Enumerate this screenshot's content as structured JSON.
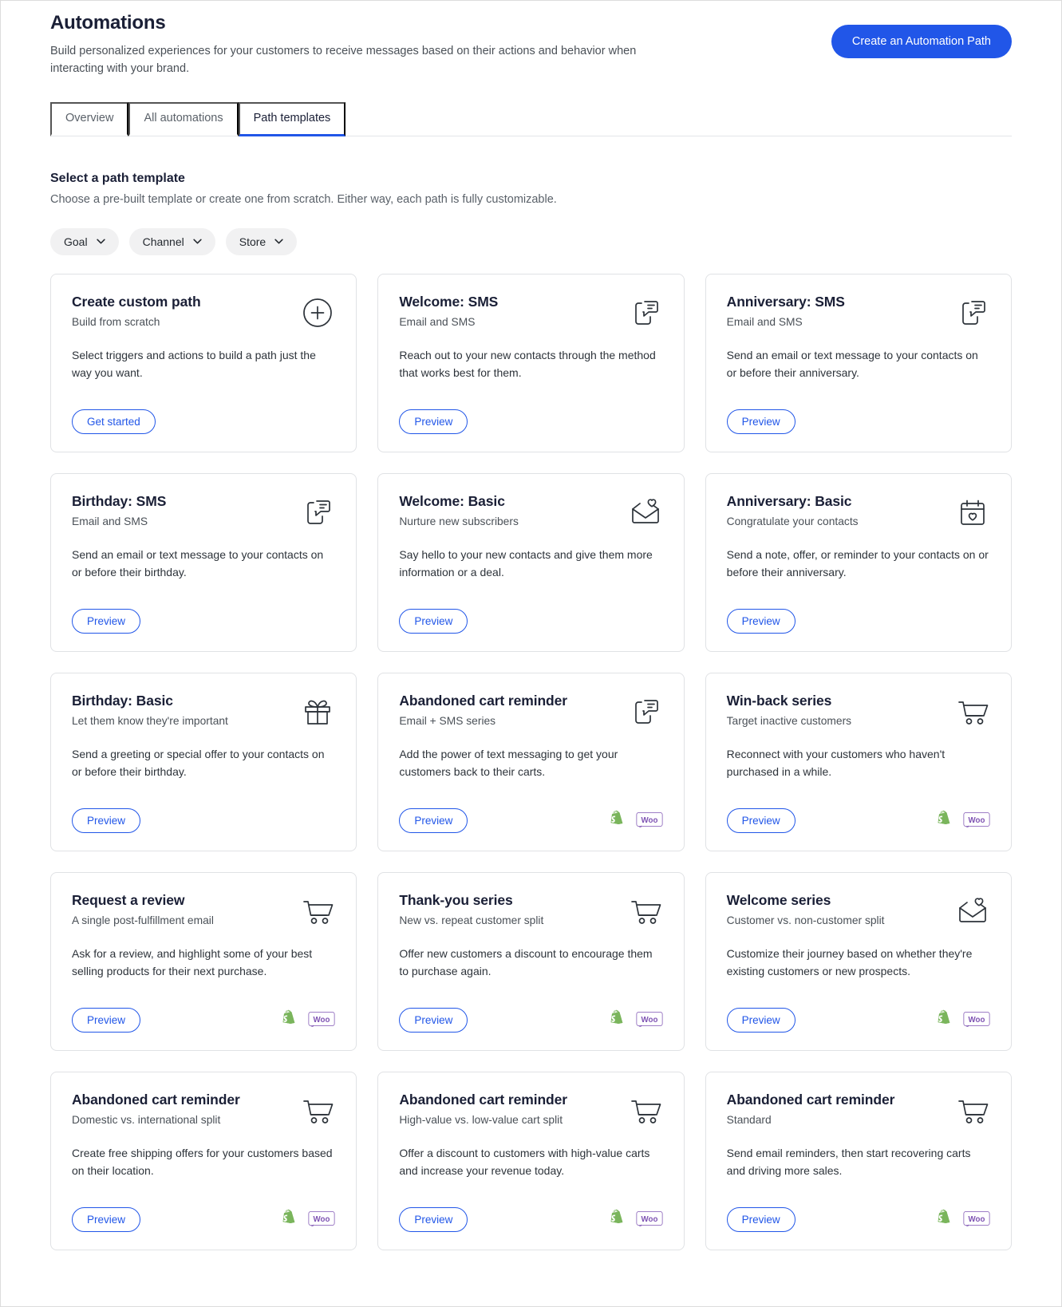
{
  "header": {
    "title": "Automations",
    "subtitle": "Build personalized experiences for your customers to receive messages based on their actions and behavior when interacting with your brand.",
    "primary_button": "Create an Automation Path"
  },
  "tabs": [
    {
      "label": "Overview",
      "active": false
    },
    {
      "label": "All automations",
      "active": false
    },
    {
      "label": "Path templates",
      "active": true
    }
  ],
  "section": {
    "title": "Select a path template",
    "subtitle": "Choose a pre-built template or create one from scratch. Either way, each path is fully customizable."
  },
  "filters": [
    {
      "label": "Goal",
      "icon": "chevron-down-icon"
    },
    {
      "label": "Channel",
      "icon": "chevron-down-icon"
    },
    {
      "label": "Store",
      "icon": "chevron-down-icon"
    }
  ],
  "colors": {
    "accent": "#2156e8",
    "shopify_green": "#7ab55c",
    "woo_purple": "#7f54b3",
    "chip_bg": "#f1f1f2",
    "card_border": "#e0e2e5"
  },
  "cards": [
    {
      "title": "Create custom path",
      "subtitle": "Build from scratch",
      "description": "Select triggers and actions to build a path just the way you want.",
      "button": "Get started",
      "icon": "plus-circle-icon",
      "badges": []
    },
    {
      "title": "Welcome: SMS",
      "subtitle": "Email and SMS",
      "description": "Reach out to your new contacts through the method that works best for them.",
      "button": "Preview",
      "icon": "sms-phone-icon",
      "badges": []
    },
    {
      "title": "Anniversary: SMS",
      "subtitle": "Email and SMS",
      "description": "Send an email or text message to your contacts on or before their anniversary.",
      "button": "Preview",
      "icon": "sms-phone-icon",
      "badges": []
    },
    {
      "title": "Birthday: SMS",
      "subtitle": "Email and SMS",
      "description": "Send an email or text message to your contacts on or before their birthday.",
      "button": "Preview",
      "icon": "sms-phone-icon",
      "badges": []
    },
    {
      "title": "Welcome: Basic",
      "subtitle": "Nurture new subscribers",
      "description": "Say hello to your new contacts and give them more information or a deal.",
      "button": "Preview",
      "icon": "envelope-heart-icon",
      "badges": []
    },
    {
      "title": "Anniversary: Basic",
      "subtitle": "Congratulate your contacts",
      "description": "Send a note, offer, or reminder to your contacts on or before their anniversary.",
      "button": "Preview",
      "icon": "calendar-heart-icon",
      "badges": []
    },
    {
      "title": "Birthday: Basic",
      "subtitle": "Let them know they're important",
      "description": "Send a greeting or special offer to your contacts on or before their birthday.",
      "button": "Preview",
      "icon": "gift-icon",
      "badges": []
    },
    {
      "title": "Abandoned cart reminder",
      "subtitle": "Email + SMS series",
      "description": "Add the power of text messaging to get your customers back to their carts.",
      "button": "Preview",
      "icon": "sms-phone-icon",
      "badges": [
        "shopify-badge",
        "woocommerce-badge"
      ]
    },
    {
      "title": "Win-back series",
      "subtitle": "Target inactive customers",
      "description": "Reconnect with your customers who haven't purchased in a while.",
      "button": "Preview",
      "icon": "shopping-cart-icon",
      "badges": [
        "shopify-badge",
        "woocommerce-badge"
      ]
    },
    {
      "title": "Request a review",
      "subtitle": "A single post-fulfillment email",
      "description": "Ask for a review, and highlight some of your best selling products for their next purchase.",
      "button": "Preview",
      "icon": "shopping-cart-icon",
      "badges": [
        "shopify-badge",
        "woocommerce-badge"
      ]
    },
    {
      "title": "Thank-you series",
      "subtitle": "New vs. repeat customer split",
      "description": "Offer new customers a discount to encourage them to purchase again.",
      "button": "Preview",
      "icon": "shopping-cart-icon",
      "badges": [
        "shopify-badge",
        "woocommerce-badge"
      ]
    },
    {
      "title": "Welcome series",
      "subtitle": "Customer vs. non-customer split",
      "description": "Customize their journey based on whether they're existing customers or new prospects.",
      "button": "Preview",
      "icon": "envelope-heart-icon",
      "badges": [
        "shopify-badge",
        "woocommerce-badge"
      ]
    },
    {
      "title": "Abandoned cart reminder",
      "subtitle": "Domestic vs. international split",
      "description": "Create free shipping offers for your customers based on their location.",
      "button": "Preview",
      "icon": "shopping-cart-icon",
      "badges": [
        "shopify-badge",
        "woocommerce-badge"
      ]
    },
    {
      "title": "Abandoned cart reminder",
      "subtitle": "High-value vs. low-value cart split",
      "description": "Offer a discount to customers with high-value carts and increase your revenue today.",
      "button": "Preview",
      "icon": "shopping-cart-icon",
      "badges": [
        "shopify-badge",
        "woocommerce-badge"
      ]
    },
    {
      "title": "Abandoned cart reminder",
      "subtitle": "Standard",
      "description": "Send email reminders, then start recovering carts and driving more sales.",
      "button": "Preview",
      "icon": "shopping-cart-icon",
      "badges": [
        "shopify-badge",
        "woocommerce-badge"
      ]
    }
  ]
}
